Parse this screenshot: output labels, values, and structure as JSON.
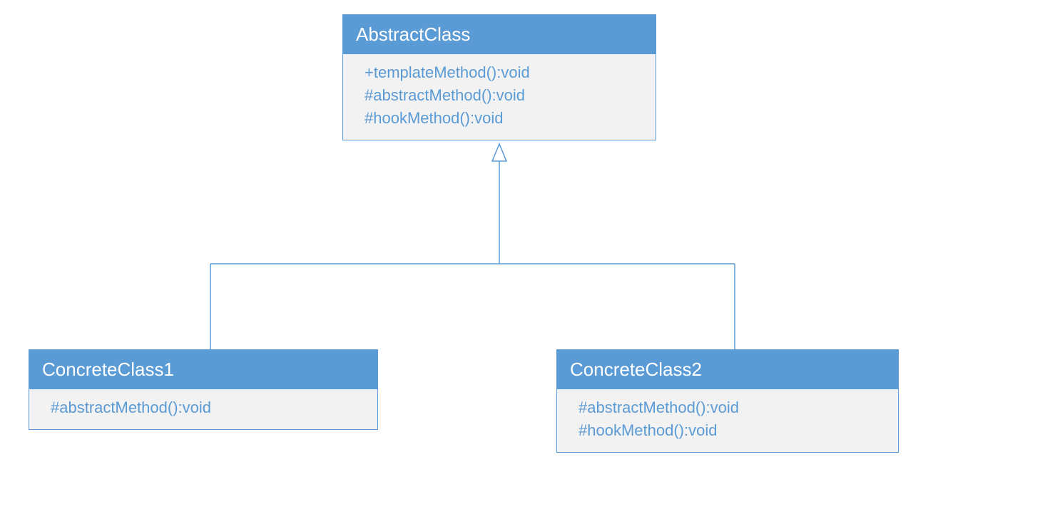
{
  "diagram": {
    "type": "uml-class-diagram",
    "abstract": {
      "name": "AbstractClass",
      "methods": [
        "+templateMethod():void",
        "#abstractMethod():void",
        "#hookMethod():void"
      ]
    },
    "concrete1": {
      "name": "ConcreteClass1",
      "methods": [
        "#abstractMethod():void"
      ]
    },
    "concrete2": {
      "name": "ConcreteClass2",
      "methods": [
        "#abstractMethod():void",
        "#hookMethod():void"
      ]
    }
  }
}
